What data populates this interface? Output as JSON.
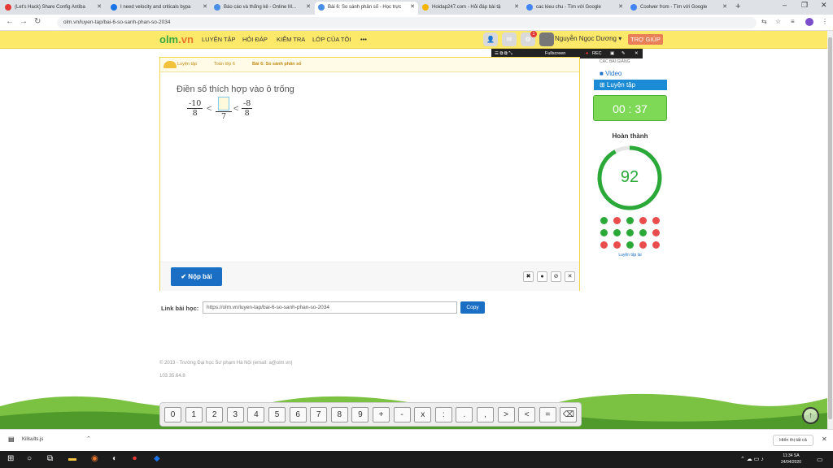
{
  "browser": {
    "tabs": [
      {
        "title": "(Let's Hack) Share Config Antiba",
        "color": "#e53935",
        "active": false
      },
      {
        "title": "I need velocity and criticals bypa",
        "color": "#1a73e8",
        "active": false
      },
      {
        "title": "Báo cáo và thống kê - Online M...",
        "color": "#4a8fe7",
        "active": false
      },
      {
        "title": "Bài 6: So sánh phân số - Học trực",
        "color": "#4a8fe7",
        "active": true
      },
      {
        "title": "Hoidap247.com - Hỏi đáp bài tậ",
        "color": "#f4b400",
        "active": false
      },
      {
        "title": "cac kieu chu - Tìm với Google",
        "color": "#4285f4",
        "active": false
      },
      {
        "title": "Coolwer from - Tìm với Google",
        "color": "#4285f4",
        "active": false
      }
    ],
    "new_tab": "+",
    "url": "olm.vn/luyen-tap/bai-6-so-sanh-phan-so-2034"
  },
  "header": {
    "logo_main": "olm",
    "logo_ext": ".vn",
    "nav": [
      "LUYỆN TẬP",
      "HỎI ĐÁP",
      "KIỂM TRA",
      "LỚP CỦA TÔI"
    ],
    "more": "•••",
    "notif_count": "1",
    "username": "Nguyễn Ngọc Dương ▾",
    "help": "TRỢ GIÚP"
  },
  "recorder": {
    "label": "Fullscreen",
    "rec": "REC"
  },
  "breadcrumb": [
    "Luyện tập",
    "Toán lớp 6",
    "Bài 6: So sánh phân số"
  ],
  "exercise": {
    "prompt": "Điền số thích hợp vào ô trống",
    "fractions": [
      {
        "num": "-10",
        "den": "8"
      },
      {
        "num": "",
        "den": "7"
      },
      {
        "num": "-8",
        "den": "8"
      }
    ],
    "operator": "<"
  },
  "submit": "✔ Nộp bài",
  "controls": [
    "✖",
    "●",
    "⊘",
    "✕"
  ],
  "link": {
    "label": "Link bài học:",
    "value": "https://olm.vn/luyen-tap/bai-6-so-sanh-phan-so-2034",
    "copy": "Copy"
  },
  "footer": {
    "line1": "© 2013 - Trường Đại học Sư phạm Hà Nội (email: a@olm.vn)",
    "line2": "103.35.64.8"
  },
  "sidebar": {
    "lessons_label": "CÁC BÀI GIẢNG",
    "video": "Video",
    "practice": "⊞ Luyện tập",
    "timer": "00 : 37",
    "done_label": "Hoàn thành",
    "score": "92",
    "progress": 0.92,
    "results": [
      "green",
      "red",
      "green",
      "red",
      "red",
      "green",
      "green",
      "green",
      "green",
      "red",
      "red",
      "red",
      "green",
      "red",
      "red"
    ],
    "retry": "Luyện tập lại",
    "colors": {
      "green": "#2aa838",
      "red": "#e84c4c"
    }
  },
  "keypad": [
    "0",
    "1",
    "2",
    "3",
    "4",
    "5",
    "6",
    "7",
    "8",
    "9",
    "+",
    "-",
    "x",
    ":",
    ".",
    ",",
    ">",
    "<",
    "=",
    "⌫"
  ],
  "downloads": {
    "file": "Killsults.js",
    "show_all": "Hiển thị tất cả"
  },
  "taskbar": {
    "time": "11:34 SA",
    "date": "24/04/2020"
  }
}
